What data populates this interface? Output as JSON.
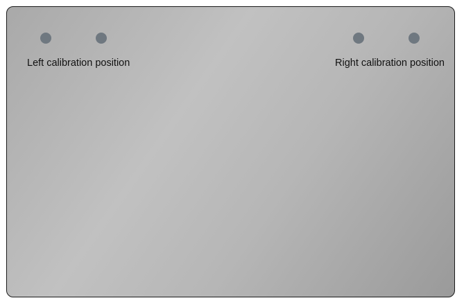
{
  "calibration": {
    "left": {
      "label": "Left calibration position",
      "point_count": 2
    },
    "right": {
      "label": "Right calibration position",
      "point_count": 2
    }
  },
  "colors": {
    "panel_gradient_light": "#c1c1c1",
    "panel_gradient_dark": "#9a9a9a",
    "marker": "#6f7880",
    "border": "#1a1a1a"
  }
}
